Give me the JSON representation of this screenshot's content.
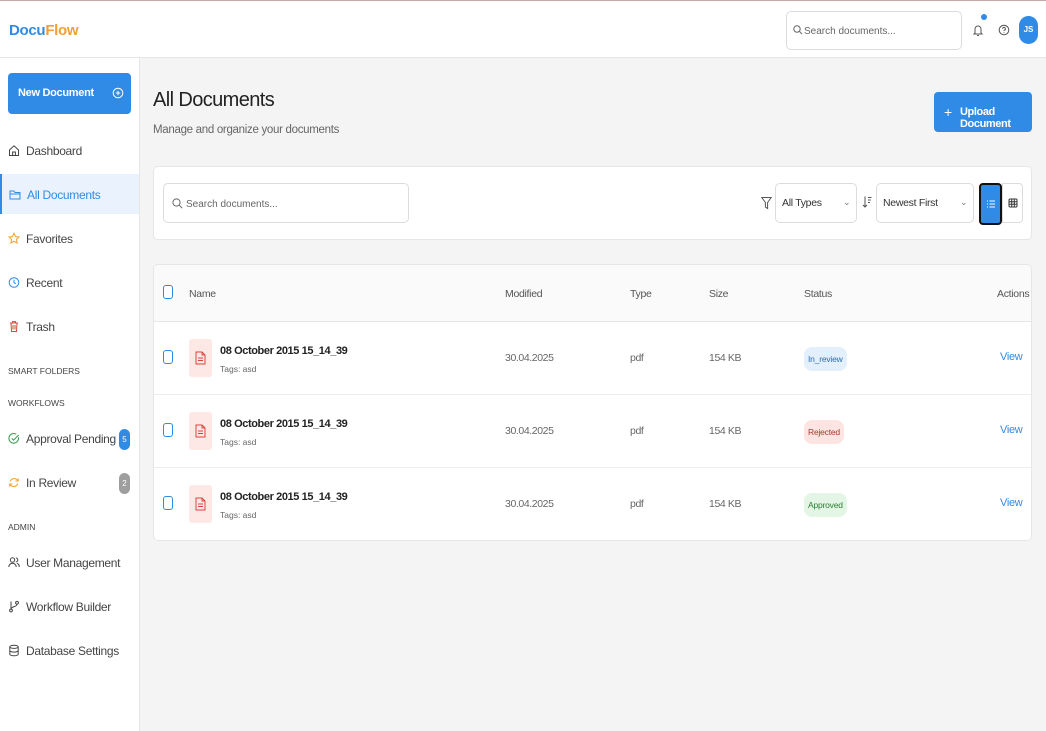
{
  "app": {
    "logo_part1": "Docu",
    "logo_part2": "Flow",
    "brand_color": "#2f8be6",
    "logo_accent_color": "#f0a030"
  },
  "header": {
    "search_placeholder": "Search documents...",
    "avatar_initials": "JS",
    "notification_dot": true
  },
  "sidebar": {
    "new_document_label": "New Document",
    "nav": [
      {
        "label": "Dashboard",
        "icon": "home-icon"
      },
      {
        "label": "All Documents",
        "icon": "folder-icon",
        "active": true
      },
      {
        "label": "Favorites",
        "icon": "star-icon"
      },
      {
        "label": "Recent",
        "icon": "clock-icon"
      },
      {
        "label": "Trash",
        "icon": "trash-icon"
      }
    ],
    "sections": {
      "smart_folders": "SMART FOLDERS",
      "workflows": "WORKFLOWS",
      "admin": "ADMIN"
    },
    "workflows": [
      {
        "label": "Approval Pending",
        "icon": "check-circle-icon",
        "count": "5",
        "badge_color": "#2f8be6"
      },
      {
        "label": "In Review",
        "icon": "refresh-icon",
        "count": "2",
        "badge_color": "#9e9e9e"
      }
    ],
    "admin": [
      {
        "label": "User Management",
        "icon": "users-icon"
      },
      {
        "label": "Workflow Builder",
        "icon": "git-branch-icon"
      },
      {
        "label": "Database Settings",
        "icon": "database-icon"
      }
    ]
  },
  "main": {
    "title": "All Documents",
    "subtitle": "Manage and organize your documents",
    "upload_label": "Upload Document",
    "upload_plus": "+"
  },
  "filters": {
    "search_placeholder": "Search documents...",
    "type_value": "All Types",
    "sort_value": "Newest First",
    "view_mode": "list"
  },
  "table": {
    "headers": {
      "name": "Name",
      "modified": "Modified",
      "type": "Type",
      "size": "Size",
      "status": "Status",
      "actions": "Actions"
    },
    "rows": [
      {
        "name": "08 October 2015 15_14_39",
        "tags": "Tags: asd",
        "modified": "30.04.2025",
        "type": "pdf",
        "size": "154 KB",
        "status": "In_review",
        "status_bg": "#e3effb",
        "status_fg": "#2a6fb5",
        "action": "View"
      },
      {
        "name": "08 October 2015 15_14_39",
        "tags": "Tags: asd",
        "modified": "30.04.2025",
        "type": "pdf",
        "size": "154 KB",
        "status": "Rejected",
        "status_bg": "#fce4e2",
        "status_fg": "#a33a30",
        "action": "View"
      },
      {
        "name": "08 October 2015 15_14_39",
        "tags": "Tags: asd",
        "modified": "30.04.2025",
        "type": "pdf",
        "size": "154 KB",
        "status": "Approved",
        "status_bg": "#e3f6e5",
        "status_fg": "#2e7d32",
        "action": "View"
      }
    ]
  }
}
